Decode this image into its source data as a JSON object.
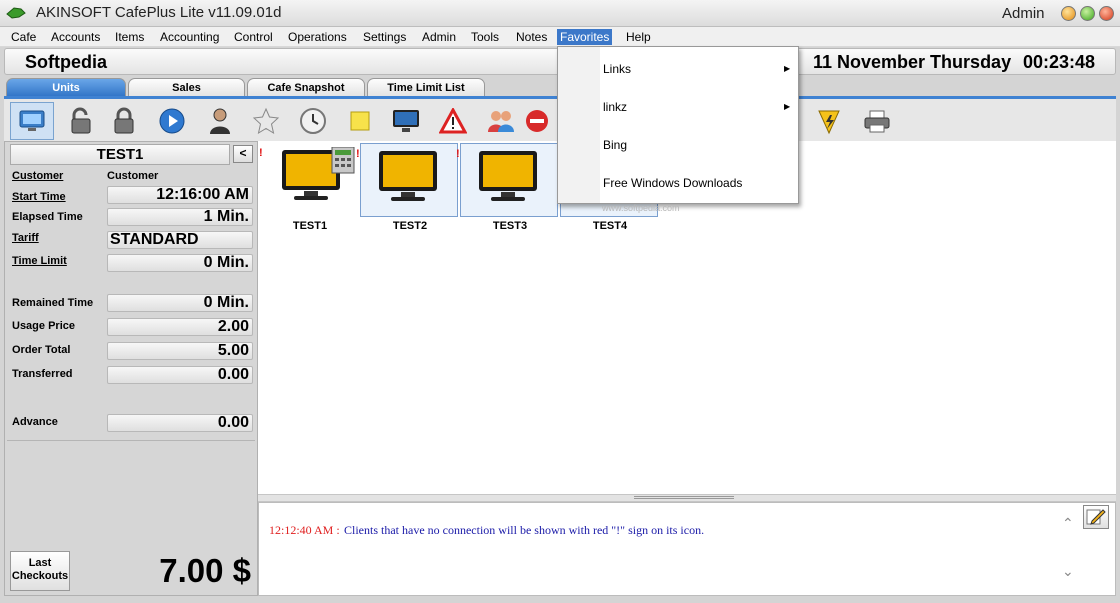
{
  "window": {
    "title": "AKINSOFT CafePlus Lite v11.09.01d",
    "user": "Admin"
  },
  "menubar": [
    "Cafe",
    "Accounts",
    "Items",
    "Accounting",
    "Control",
    "Operations",
    "Settings",
    "Admin",
    "Tools",
    "Notes",
    "Favorites",
    "Help"
  ],
  "menubar_active": "Favorites",
  "header": {
    "brand": "Softpedia",
    "date": "11 November Thursday",
    "time": "00:23:48"
  },
  "tabs": [
    "Units",
    "Sales",
    "Cafe Snapshot",
    "Time Limit List"
  ],
  "toolbar_icons": [
    "monitor-icon",
    "unlock-icon",
    "lock-icon",
    "play-icon",
    "user-icon",
    "star-icon",
    "clock-icon",
    "note-icon",
    "screen-icon",
    "warning-icon",
    "users-icon",
    "stop-icon",
    "lightning-icon",
    "printer-icon"
  ],
  "left_panel": {
    "unit_name": "TEST1",
    "back_label": "<",
    "customer_label": "Customer",
    "customer_value": "Customer",
    "start_time_label": "Start Time",
    "start_time_value": "12:16:00 AM",
    "elapsed_label": "Elapsed Time",
    "elapsed_value": "1 Min.",
    "tariff_label": "Tariff",
    "tariff_value": "STANDARD",
    "time_limit_label": "Time Limit",
    "time_limit_value": "0 Min.",
    "remained_label": "Remained Time",
    "remained_value": "0 Min.",
    "usage_label": "Usage Price",
    "usage_value": "2.00",
    "order_label": "Order Total",
    "order_value": "5.00",
    "transferred_label": "Transferred",
    "transferred_value": "0.00",
    "advance_label": "Advance",
    "advance_value": "0.00",
    "last_checkouts_label": "Last Checkouts",
    "total": "7.00 $"
  },
  "units": [
    {
      "name": "TEST1",
      "alert": "!"
    },
    {
      "name": "TEST2",
      "alert": "!"
    },
    {
      "name": "TEST3",
      "alert": "!"
    },
    {
      "name": "TEST4",
      "alert": ""
    }
  ],
  "log": {
    "time": "12:12:40 AM :",
    "message": "Clients that have no connection will be shown with red \"!\" sign on its icon."
  },
  "favorites_menu": {
    "items": [
      "Links",
      "linkz",
      "Bing",
      "Free Windows Downloads"
    ]
  },
  "watermark": "www.softpedia.com",
  "colors": {
    "accent": "#2f73c6",
    "alert": "#e01010",
    "log_time": "#e02020",
    "log_msg": "#1a1aa8"
  }
}
